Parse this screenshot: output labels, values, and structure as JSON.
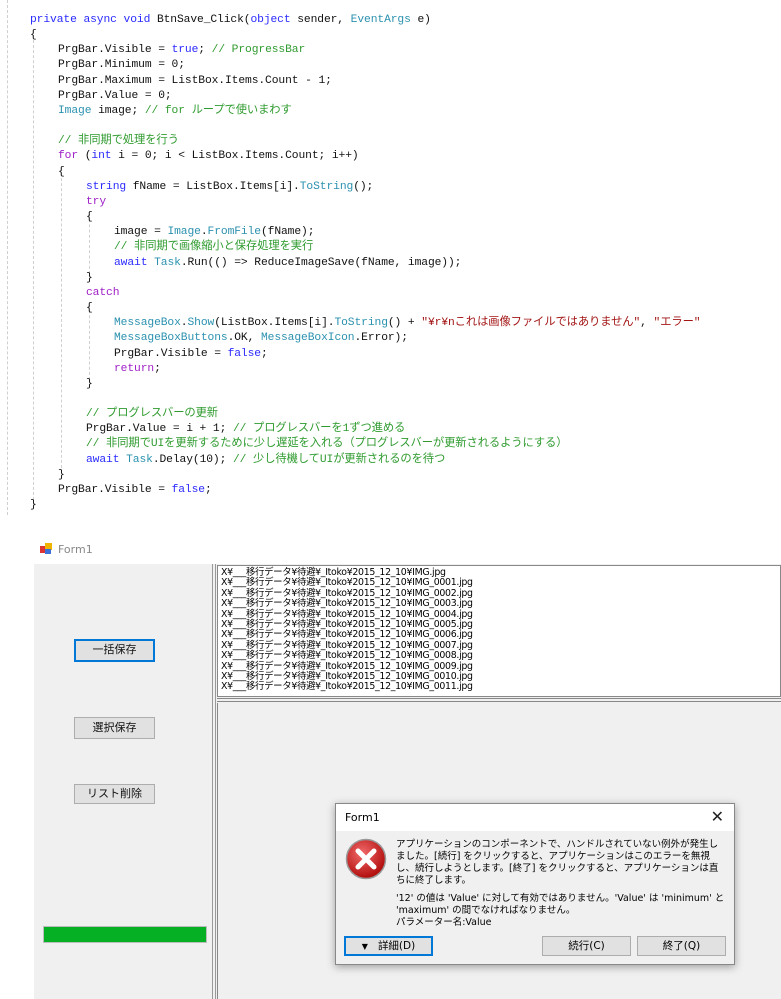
{
  "code": {
    "lines": [
      {
        "indent": 0,
        "tokens": [
          [
            "private",
            "kw"
          ],
          [
            " ",
            "pl"
          ],
          [
            "async",
            "kw"
          ],
          [
            " ",
            "pl"
          ],
          [
            "void",
            "kw"
          ],
          [
            " BtnSave_Click(",
            "pl"
          ],
          [
            "object",
            "kw"
          ],
          [
            " sender, ",
            "pl"
          ],
          [
            "EventArgs",
            "ty"
          ],
          [
            " e)",
            "pl"
          ]
        ]
      },
      {
        "indent": 0,
        "tokens": [
          [
            "{",
            "pl"
          ]
        ]
      },
      {
        "indent": 1,
        "tokens": [
          [
            "PrgBar.Visible = ",
            "pl"
          ],
          [
            "true",
            "kw"
          ],
          [
            "; ",
            "pl"
          ],
          [
            "// ProgressBar",
            "cm"
          ]
        ]
      },
      {
        "indent": 1,
        "tokens": [
          [
            "PrgBar.Minimum = 0;",
            "pl"
          ]
        ]
      },
      {
        "indent": 1,
        "tokens": [
          [
            "PrgBar.Maximum = ListBox.Items.Count - 1;",
            "pl"
          ]
        ]
      },
      {
        "indent": 1,
        "tokens": [
          [
            "PrgBar.Value = 0;",
            "pl"
          ]
        ]
      },
      {
        "indent": 1,
        "tokens": [
          [
            "Image",
            "ty"
          ],
          [
            " image; ",
            "pl"
          ],
          [
            "// for ループで使いまわす",
            "cm"
          ]
        ]
      },
      {
        "indent": 0,
        "tokens": []
      },
      {
        "indent": 1,
        "tokens": [
          [
            "// 非同期で処理を行う",
            "cm"
          ]
        ]
      },
      {
        "indent": 1,
        "tokens": [
          [
            "for",
            "ct"
          ],
          [
            " (",
            "pl"
          ],
          [
            "int",
            "kw"
          ],
          [
            " i = 0; i < ListBox.Items.Count; i++)",
            "pl"
          ]
        ]
      },
      {
        "indent": 1,
        "tokens": [
          [
            "{",
            "pl"
          ]
        ]
      },
      {
        "indent": 2,
        "tokens": [
          [
            "string",
            "kw"
          ],
          [
            " fName = ListBox.Items[i].",
            "pl"
          ],
          [
            "ToString",
            "ty"
          ],
          [
            "();",
            "pl"
          ]
        ]
      },
      {
        "indent": 2,
        "tokens": [
          [
            "try",
            "ct"
          ]
        ]
      },
      {
        "indent": 2,
        "tokens": [
          [
            "{",
            "pl"
          ]
        ]
      },
      {
        "indent": 3,
        "tokens": [
          [
            "image = ",
            "pl"
          ],
          [
            "Image",
            "ty"
          ],
          [
            ".",
            "pl"
          ],
          [
            "FromFile",
            "ty"
          ],
          [
            "(fName);",
            "pl"
          ]
        ]
      },
      {
        "indent": 3,
        "tokens": [
          [
            "// 非同期で画像縮小と保存処理を実行",
            "cm"
          ]
        ]
      },
      {
        "indent": 3,
        "tokens": [
          [
            "await",
            "kw"
          ],
          [
            " ",
            "pl"
          ],
          [
            "Task",
            "ty"
          ],
          [
            ".Run(() => ReduceImageSave(fName, image));",
            "pl"
          ]
        ]
      },
      {
        "indent": 2,
        "tokens": [
          [
            "}",
            "pl"
          ]
        ]
      },
      {
        "indent": 2,
        "tokens": [
          [
            "catch",
            "ct"
          ]
        ]
      },
      {
        "indent": 2,
        "tokens": [
          [
            "{",
            "pl"
          ]
        ]
      },
      {
        "indent": 3,
        "tokens": [
          [
            "MessageBox",
            "ty"
          ],
          [
            ".",
            "pl"
          ],
          [
            "Show",
            "ty"
          ],
          [
            "(ListBox.Items[i].",
            "pl"
          ],
          [
            "ToString",
            "ty"
          ],
          [
            "() + ",
            "pl"
          ],
          [
            "\"¥r¥nこれは画像ファイルではありません\"",
            "st"
          ],
          [
            ", ",
            "pl"
          ],
          [
            "\"エラー\"",
            "st"
          ]
        ]
      },
      {
        "indent": 3,
        "tokens": [
          [
            "MessageBoxButtons",
            "ty"
          ],
          [
            ".OK, ",
            "pl"
          ],
          [
            "MessageBoxIcon",
            "ty"
          ],
          [
            ".Error);",
            "pl"
          ]
        ]
      },
      {
        "indent": 3,
        "tokens": [
          [
            "PrgBar.Visible = ",
            "pl"
          ],
          [
            "false",
            "kw"
          ],
          [
            ";",
            "pl"
          ]
        ]
      },
      {
        "indent": 3,
        "tokens": [
          [
            "return",
            "ct"
          ],
          [
            ";",
            "pl"
          ]
        ]
      },
      {
        "indent": 2,
        "tokens": [
          [
            "}",
            "pl"
          ]
        ]
      },
      {
        "indent": 0,
        "tokens": []
      },
      {
        "indent": 2,
        "tokens": [
          [
            "// プログレスバーの更新",
            "cm"
          ]
        ]
      },
      {
        "indent": 2,
        "tokens": [
          [
            "PrgBar.Value = i + 1; ",
            "pl"
          ],
          [
            "// プログレスバーを1ずつ進める",
            "cm"
          ]
        ]
      },
      {
        "indent": 2,
        "tokens": [
          [
            "// 非同期でUIを更新するために少し遅延を入れる（プログレスバーが更新されるようにする）",
            "cm"
          ]
        ]
      },
      {
        "indent": 2,
        "tokens": [
          [
            "await",
            "kw"
          ],
          [
            " ",
            "pl"
          ],
          [
            "Task",
            "ty"
          ],
          [
            ".Delay(10); ",
            "pl"
          ],
          [
            "// 少し待機してUIが更新されるのを待つ",
            "cm"
          ]
        ]
      },
      {
        "indent": 1,
        "tokens": [
          [
            "}",
            "pl"
          ]
        ]
      },
      {
        "indent": 1,
        "tokens": [
          [
            "PrgBar.Visible = ",
            "pl"
          ],
          [
            "false",
            "kw"
          ],
          [
            ";",
            "pl"
          ]
        ]
      },
      {
        "indent": 0,
        "tokens": [
          [
            "}",
            "pl"
          ]
        ]
      }
    ]
  },
  "form": {
    "title": "Form1",
    "buttons": {
      "bulk_save": "一括保存",
      "selected_save": "選択保存",
      "list_delete": "リスト削除"
    },
    "progress": {
      "value_percent": 100,
      "color": "#06b025"
    },
    "listbox_items": [
      "X¥___移行データ¥待避¥_Itoko¥2015_12_10¥IMG.jpg",
      "X¥___移行データ¥待避¥_Itoko¥2015_12_10¥IMG_0001.jpg",
      "X¥___移行データ¥待避¥_Itoko¥2015_12_10¥IMG_0002.jpg",
      "X¥___移行データ¥待避¥_Itoko¥2015_12_10¥IMG_0003.jpg",
      "X¥___移行データ¥待避¥_Itoko¥2015_12_10¥IMG_0004.jpg",
      "X¥___移行データ¥待避¥_Itoko¥2015_12_10¥IMG_0005.jpg",
      "X¥___移行データ¥待避¥_Itoko¥2015_12_10¥IMG_0006.jpg",
      "X¥___移行データ¥待避¥_Itoko¥2015_12_10¥IMG_0007.jpg",
      "X¥___移行データ¥待避¥_Itoko¥2015_12_10¥IMG_0008.jpg",
      "X¥___移行データ¥待避¥_Itoko¥2015_12_10¥IMG_0009.jpg",
      "X¥___移行データ¥待避¥_Itoko¥2015_12_10¥IMG_0010.jpg",
      "X¥___移行データ¥待避¥_Itoko¥2015_12_10¥IMG_0011.jpg"
    ]
  },
  "dialog": {
    "title": "Form1",
    "close": "✕",
    "icon": "error-icon",
    "message1": "アプリケーションのコンポーネントで、ハンドルされていない例外が発生しました。[続行] をクリックすると、アプリケーションはこのエラーを無視し、続行しようとします。[終了] をクリックすると、アプリケーションは直ちに終了します。",
    "message2": "'12' の値は 'Value' に対して有効ではありません。'Value' は 'minimum' と 'maximum' の間でなければなりません。",
    "message3": "パラメーター名:Value",
    "details_button": "詳細(D)",
    "continue_button": "続行(C)",
    "quit_button": "終了(Q)"
  }
}
